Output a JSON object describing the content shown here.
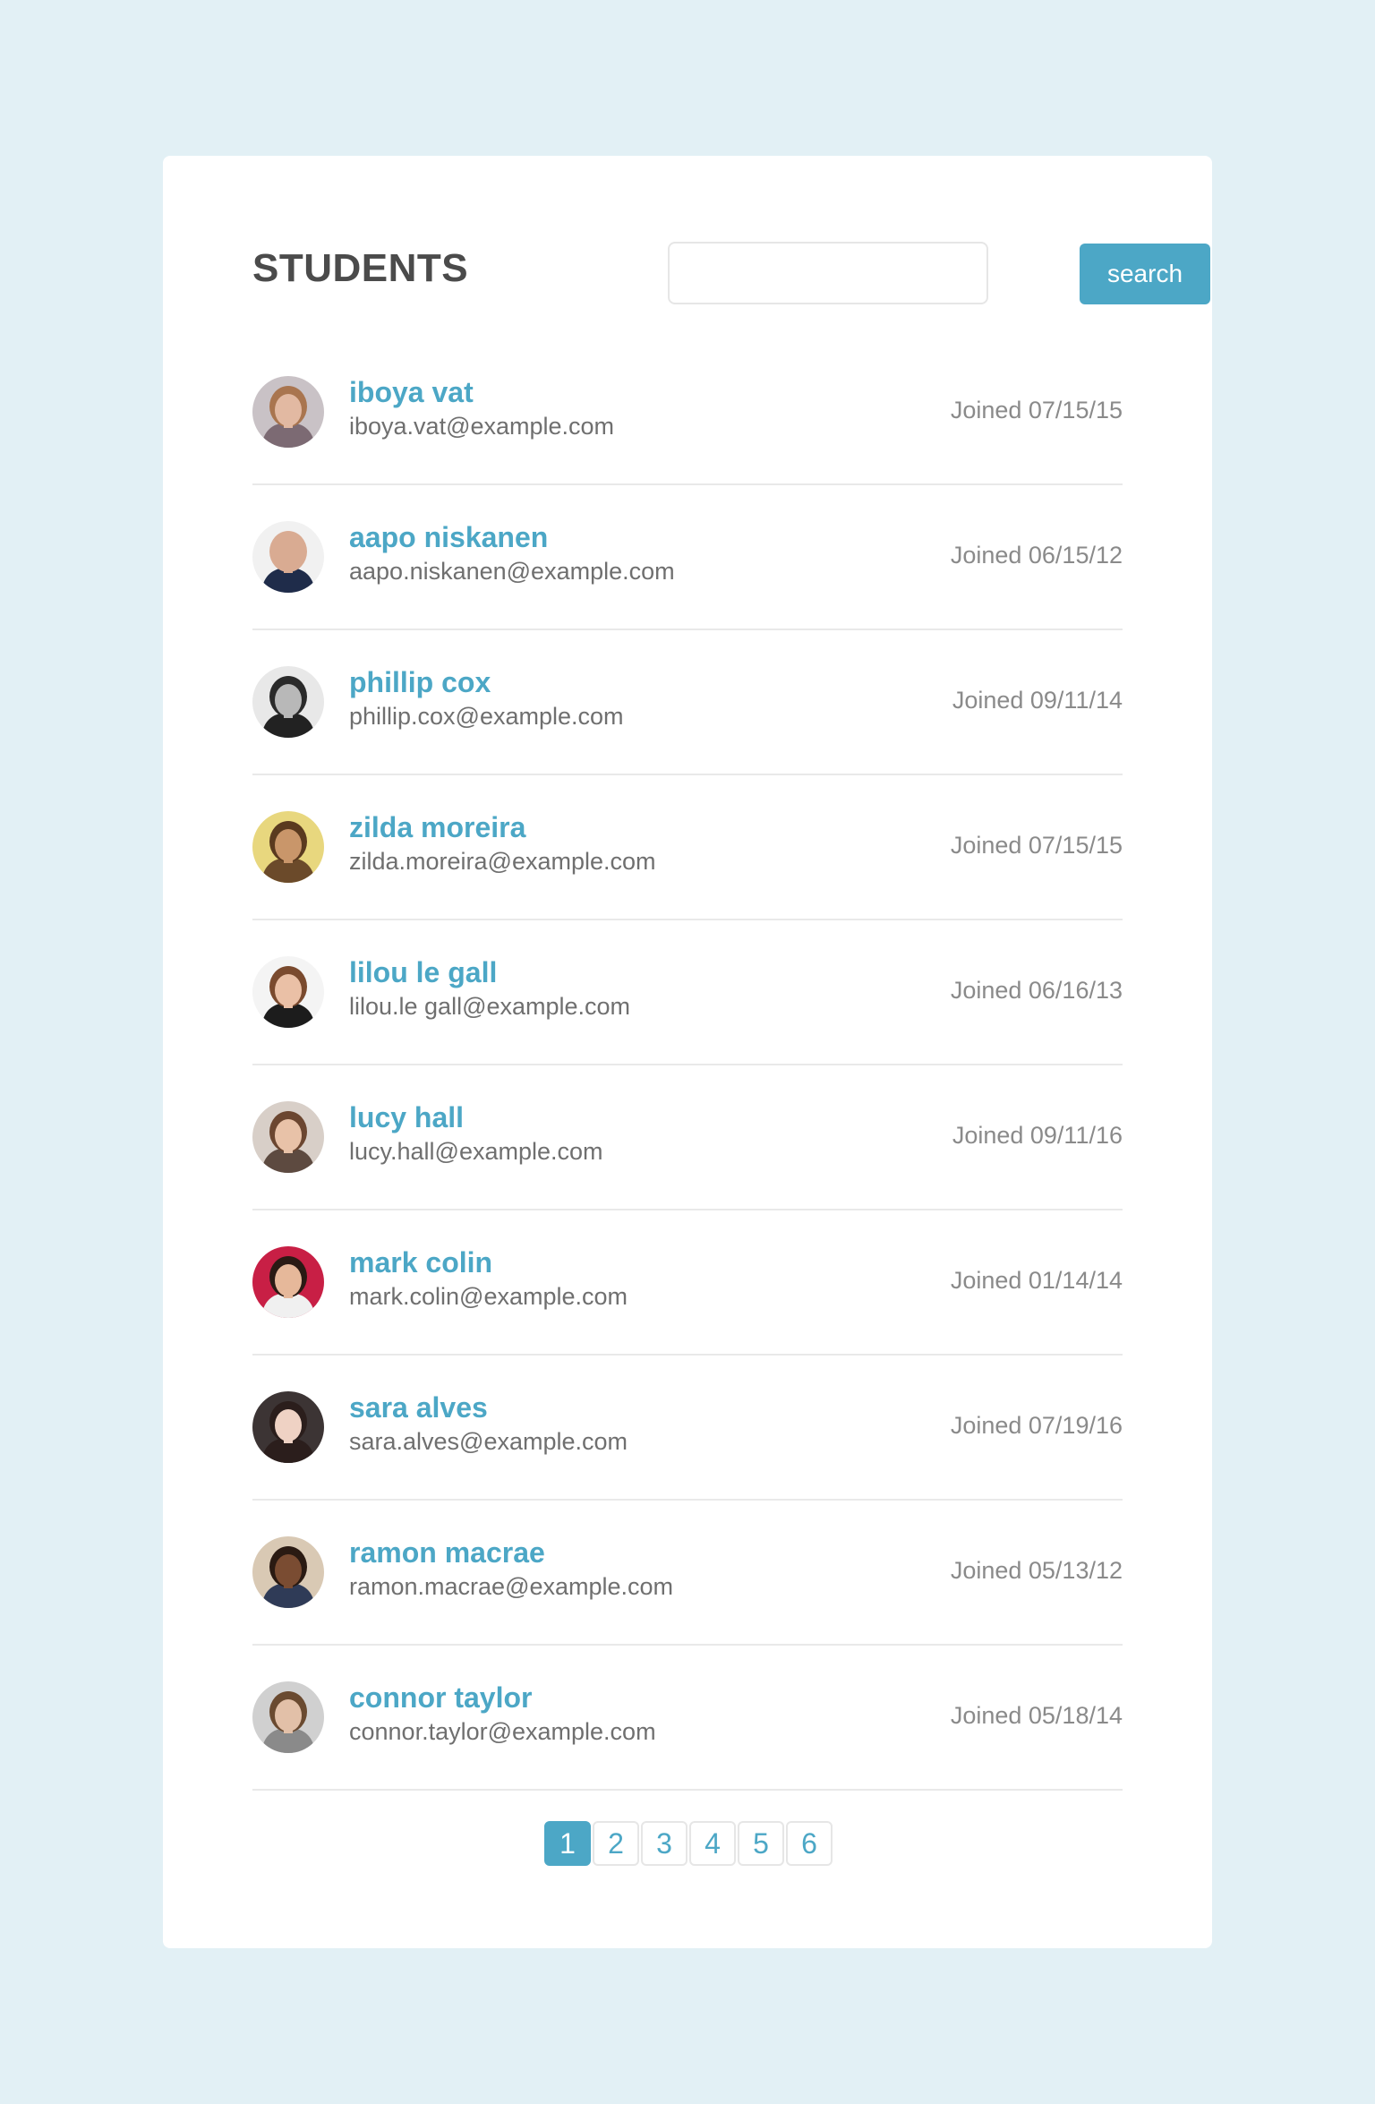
{
  "header": {
    "title": "STUDENTS",
    "search_value": "",
    "search_button_label": "search"
  },
  "students": [
    {
      "name": "iboya vat",
      "email": "iboya.vat@example.com",
      "joined": "Joined 07/15/15",
      "avatar_bg": "#c9c2c6",
      "avatar_skin": "#e2b9a2",
      "avatar_hair": "#a9754f",
      "avatar_shirt": "#7c6a73"
    },
    {
      "name": "aapo niskanen",
      "email": "aapo.niskanen@example.com",
      "joined": "Joined 06/15/12",
      "avatar_bg": "#f1f1f1",
      "avatar_skin": "#d9ab92",
      "avatar_hair": "#d9ab92",
      "avatar_shirt": "#1f2c4a"
    },
    {
      "name": "phillip cox",
      "email": "phillip.cox@example.com",
      "joined": "Joined 09/11/14",
      "avatar_bg": "#e8e8e8",
      "avatar_skin": "#b8b8b8",
      "avatar_hair": "#2a2a2a",
      "avatar_shirt": "#222222"
    },
    {
      "name": "zilda moreira",
      "email": "zilda.moreira@example.com",
      "joined": "Joined 07/15/15",
      "avatar_bg": "#e8d77e",
      "avatar_skin": "#c9966a",
      "avatar_hair": "#5a3a1f",
      "avatar_shirt": "#6b4a2a"
    },
    {
      "name": "lilou le gall",
      "email": "lilou.le gall@example.com",
      "joined": "Joined 06/16/13",
      "avatar_bg": "#f4f4f4",
      "avatar_skin": "#eac0a6",
      "avatar_hair": "#7a4a2e",
      "avatar_shirt": "#1c1c1c"
    },
    {
      "name": "lucy hall",
      "email": "lucy.hall@example.com",
      "joined": "Joined 09/11/16",
      "avatar_bg": "#d8cfc8",
      "avatar_skin": "#e8c2a8",
      "avatar_hair": "#6b4630",
      "avatar_shirt": "#5d4a40"
    },
    {
      "name": "mark colin",
      "email": "mark.colin@example.com",
      "joined": "Joined 01/14/14",
      "avatar_bg": "#c81f45",
      "avatar_skin": "#e6b89a",
      "avatar_hair": "#2a1a14",
      "avatar_shirt": "#f0f0f0"
    },
    {
      "name": "sara alves",
      "email": "sara.alves@example.com",
      "joined": "Joined 07/19/16",
      "avatar_bg": "#3c3434",
      "avatar_skin": "#efd2c4",
      "avatar_hair": "#2b1e1c",
      "avatar_shirt": "#2b1e1c"
    },
    {
      "name": "ramon macrae",
      "email": "ramon.macrae@example.com",
      "joined": "Joined 05/13/12",
      "avatar_bg": "#d9c9b4",
      "avatar_skin": "#7a4c32",
      "avatar_hair": "#2a1a12",
      "avatar_shirt": "#2f3b57"
    },
    {
      "name": "connor taylor",
      "email": "connor.taylor@example.com",
      "joined": "Joined 05/18/14",
      "avatar_bg": "#d0d0d0",
      "avatar_skin": "#e2c0a8",
      "avatar_hair": "#6a4a30",
      "avatar_shirt": "#8a8a8a"
    }
  ],
  "pagination": {
    "pages": [
      "1",
      "2",
      "3",
      "4",
      "5",
      "6"
    ],
    "current": "1"
  },
  "colors": {
    "accent": "#4ca7c6",
    "page_background": "#e2f0f5",
    "card_background": "#ffffff"
  }
}
